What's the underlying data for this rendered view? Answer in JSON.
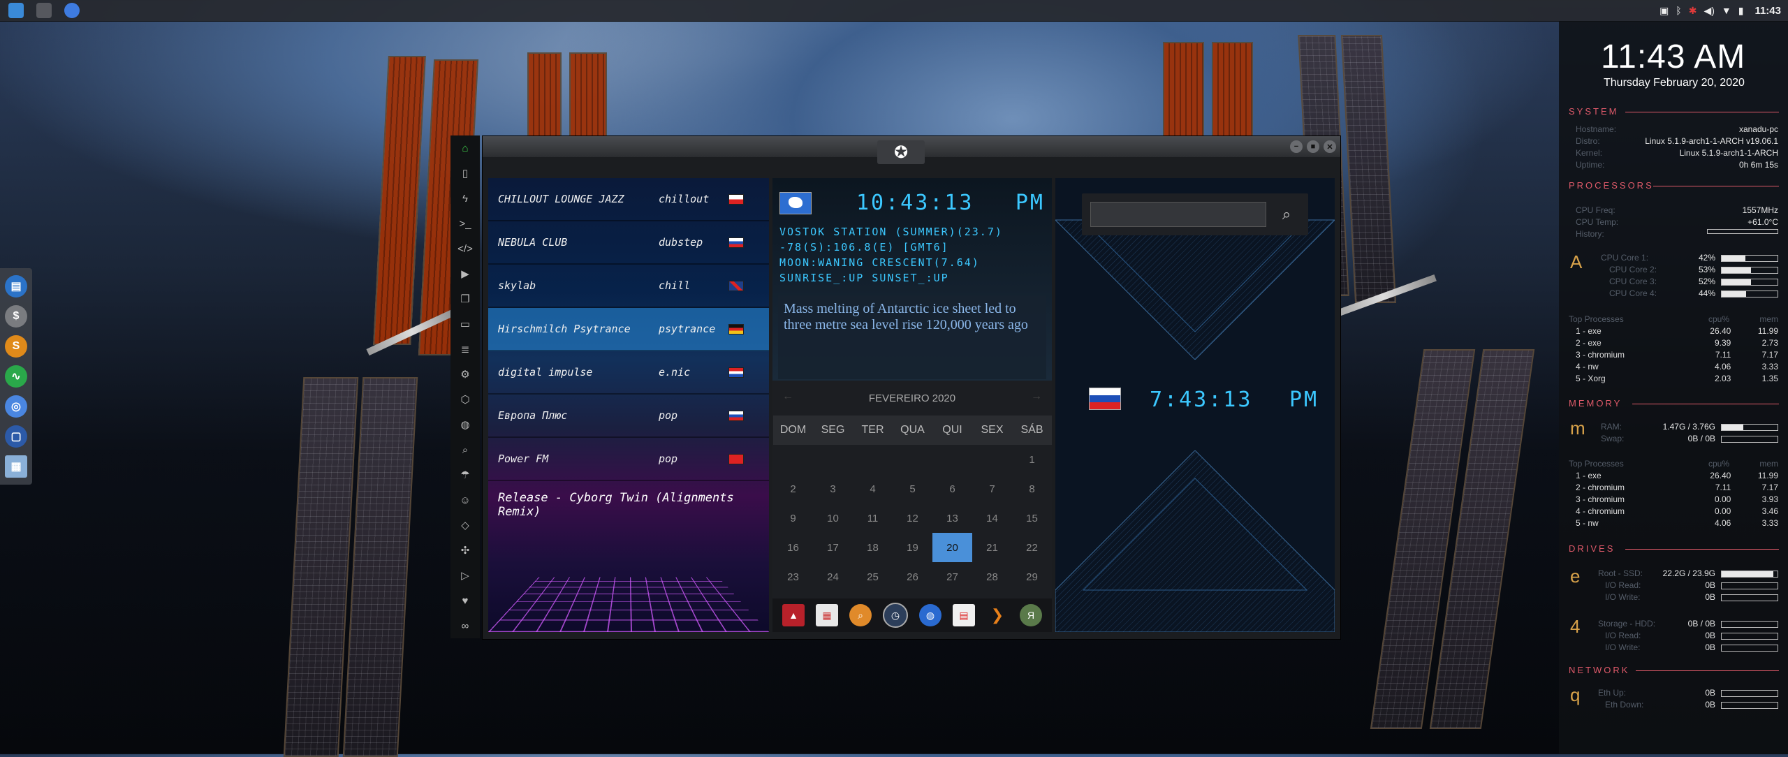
{
  "colors": {
    "accent": "#3cc8ff",
    "conky_section": "#e05a6a",
    "conky_letter": "#d8a24a",
    "today": "#4a90d9"
  },
  "topbar": {
    "clock": "11:43",
    "tray_icons": [
      "photo-icon",
      "bluetooth-icon",
      "settings-red-icon",
      "volume-icon",
      "wifi-icon",
      "battery-icon"
    ]
  },
  "window": {
    "rebel_icon": "rebel-alliance-icon",
    "minimize": "−",
    "maximize": "■",
    "close": "✕"
  },
  "sidebar_icons": [
    "home-icon",
    "document-icon",
    "bolt-icon",
    "terminal-icon",
    "code-icon",
    "play-icon",
    "pages-icon",
    "image-icon",
    "news-icon",
    "gear-icon",
    "hexagon-icon",
    "globe-icon",
    "search-icon",
    "umbrella-icon",
    "contact-icon",
    "code-tag-icon",
    "expand-icon",
    "youtube-icon",
    "heart-icon",
    "link-icon"
  ],
  "radio": {
    "stations": [
      {
        "name": "CHILLOUT LOUNGE JAZZ",
        "genre": "chillout",
        "flag": "pl",
        "active": false
      },
      {
        "name": "NEBULA CLUB",
        "genre": "dubstep",
        "flag": "ru",
        "active": false
      },
      {
        "name": "skylab",
        "genre": "chill",
        "flag": "gb",
        "active": false
      },
      {
        "name": "Hirschmilch Psytrance",
        "genre": "psytrance",
        "flag": "de",
        "active": true
      },
      {
        "name": "digital impulse",
        "genre": "e.nic",
        "flag": "hr",
        "active": false
      },
      {
        "name": "Европа Плюс",
        "genre": "pop",
        "flag": "ru",
        "active": false
      },
      {
        "name": "Power FM",
        "genre": "pop",
        "flag": "tr",
        "active": false
      }
    ],
    "now_playing": "Release - Cyborg Twin (Alignments Remix)"
  },
  "world_clock": {
    "time": "10:43:13",
    "ampm": "PM",
    "line1": "VOSTOK STATION (SUMMER)(23.7)",
    "line2": "-78(S):106.8(E) [GMT6]",
    "line3": "MOON:WANING CRESCENT(7.64)",
    "line4": "SUNRISE_:UP SUNSET_:UP",
    "headline": "Mass melting of Antarctic ice sheet led to three metre sea level rise 120,000 years ago"
  },
  "calendar": {
    "month": "FEVEREIRO 2020",
    "weekdays": [
      "DOM",
      "SEG",
      "TER",
      "QUA",
      "QUI",
      "SEX",
      "SÁB"
    ],
    "days": [
      "",
      "",
      "",
      "",
      "",
      "",
      "1",
      "2",
      "3",
      "4",
      "5",
      "6",
      "7",
      "8",
      "9",
      "10",
      "11",
      "12",
      "13",
      "14",
      "15",
      "16",
      "17",
      "18",
      "19",
      "20",
      "21",
      "22",
      "23",
      "24",
      "25",
      "26",
      "27",
      "28",
      "29"
    ],
    "today": "20"
  },
  "dock_bottom": [
    "triangle-red-icon",
    "calendar-app-icon",
    "magnifier-icon",
    "clock-icon",
    "globe-icon",
    "calendar-icon",
    "chevron-right-icon",
    "yandex-icon"
  ],
  "right_panel": {
    "search_placeholder": "",
    "search_icon": "search-icon",
    "time": "7:43:13",
    "ampm": "PM",
    "flag": "ru"
  },
  "conky": {
    "time": "11:43 AM",
    "date": "Thursday February 20, 2020",
    "system": {
      "title": "SYSTEM",
      "rows": [
        {
          "k": "Hostname:",
          "v": "xanadu-pc"
        },
        {
          "k": "Distro:",
          "v": "Linux 5.1.9-arch1-1-ARCH v19.06.1"
        },
        {
          "k": "Kernel:",
          "v": "Linux 5.1.9-arch1-1-ARCH"
        },
        {
          "k": "Uptime:",
          "v": "0h 6m 15s"
        }
      ]
    },
    "processors": {
      "title": "PROCESSORS",
      "letter": "A",
      "freq_k": "CPU Freq:",
      "freq_v": "1557MHz",
      "temp_k": "CPU Temp:",
      "temp_v": "+61.0°C",
      "history_k": "History:",
      "cores": [
        {
          "k": "CPU Core 1:",
          "v": "42%",
          "pct": 42
        },
        {
          "k": "CPU Core 2:",
          "v": "53%",
          "pct": 53
        },
        {
          "k": "CPU Core 3:",
          "v": "52%",
          "pct": 52
        },
        {
          "k": "CPU Core 4:",
          "v": "44%",
          "pct": 44
        }
      ]
    },
    "top_cpu": {
      "h1": "Top Processes",
      "h2": "cpu%",
      "h3": "mem",
      "rows": [
        [
          "1 - exe",
          "26.40",
          "11.99"
        ],
        [
          "2 - exe",
          "9.39",
          "2.73"
        ],
        [
          "3 - chromium",
          "7.11",
          "7.17"
        ],
        [
          "4 - nw",
          "4.06",
          "3.33"
        ],
        [
          "5 - Xorg",
          "2.03",
          "1.35"
        ]
      ]
    },
    "memory": {
      "title": "MEMORY",
      "letter": "m",
      "ram_k": "RAM:",
      "ram_v": "1.47G / 3.76G",
      "ram_pct": 39,
      "swap_k": "Swap:",
      "swap_v": "0B / 0B",
      "swap_pct": 0
    },
    "top_mem": {
      "h1": "Top Processes",
      "h2": "cpu%",
      "h3": "mem",
      "rows": [
        [
          "1 - exe",
          "26.40",
          "11.99"
        ],
        [
          "2 - chromium",
          "7.11",
          "7.17"
        ],
        [
          "3 - chromium",
          "0.00",
          "3.93"
        ],
        [
          "4 - chromium",
          "0.00",
          "3.46"
        ],
        [
          "5 - nw",
          "4.06",
          "3.33"
        ]
      ]
    },
    "drives": {
      "title": "DRIVES",
      "l1": "e",
      "l2": "4",
      "root_k": "Root - SSD:",
      "root_v": "22.2G / 23.9G",
      "root_pct": 93,
      "rr_k": "I/O Read:",
      "rr_v": "0B",
      "rw_k": "I/O Write:",
      "rw_v": "0B",
      "st_k": "Storage - HDD:",
      "st_v": "0B / 0B",
      "sr_k": "I/O Read:",
      "sr_v": "0B",
      "sw_k": "I/O Write:",
      "sw_v": "0B"
    },
    "network": {
      "title": "NETWORK",
      "letter": "q",
      "up_k": "Eth Up:",
      "up_v": "0B",
      "down_k": "Eth Down:",
      "down_v": "0B"
    }
  }
}
